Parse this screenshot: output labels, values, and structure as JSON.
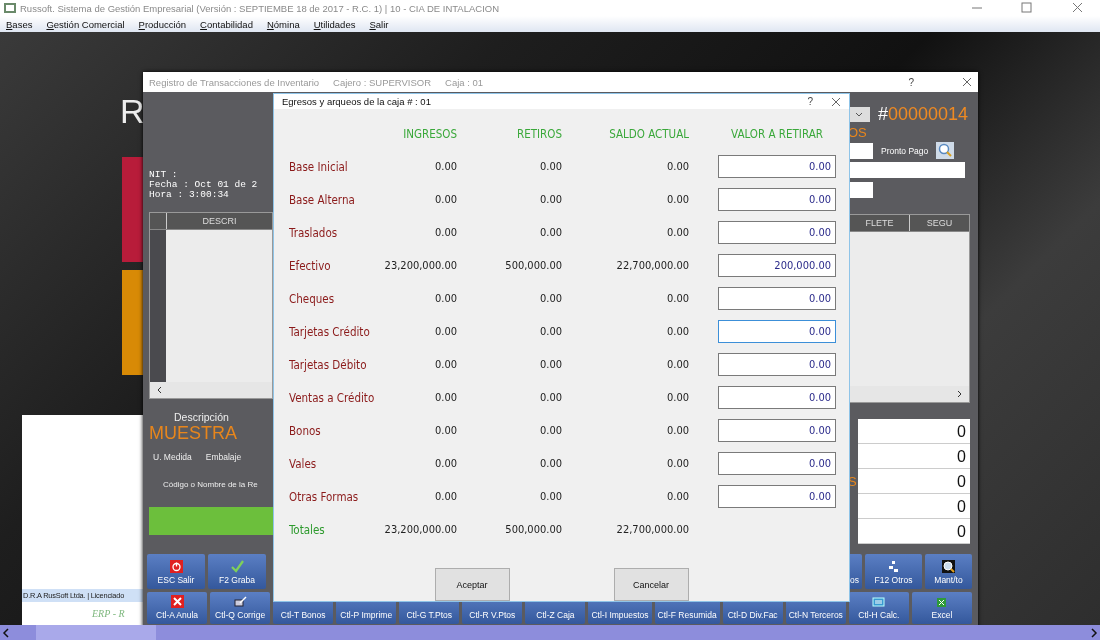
{
  "app": {
    "title": "Russoft. Sistema de Gestión Empresarial (Versión : SEPTIEMBE 18 de 2017 - R.C. 1) | 10 - CIA DE INTALACION"
  },
  "menu": [
    "Bases",
    "Gestión Comercial",
    "Producción",
    "Contabilidad",
    "Nómina",
    "Utilidades",
    "Salir"
  ],
  "desktop": {
    "logo_letter": "R",
    "license_text": "D.R.A RusSoft Ltda. | Licenciado",
    "logo_caption": "ERP - R"
  },
  "inventory_window": {
    "title": "Registro de Transacciones de Inventario",
    "cashier": "Cajero : SUPERVISOR",
    "box": "Caja : 01",
    "help": "?",
    "info": [
      "NIT :",
      "Fecha : Oct 01 de 2",
      "Hora  :  3:00:34"
    ],
    "grid_left_header": "DESCRI",
    "description_label": "Descripción",
    "product": "MUESTRA",
    "unit_labels": [
      "U. Medida",
      "Embalaje"
    ],
    "search_label": "Código o Nombre de la Re",
    "document_number_prefix": "#",
    "document_number": "00000014",
    "status_fragment": "OS",
    "pronto_pago": "Pronto Pago",
    "grid_right_headers": [
      "FLETE",
      "SEGU"
    ],
    "totals_fragment": "S",
    "totals": [
      "0",
      "0",
      "0",
      "0",
      "0"
    ],
    "buttons_top_left": [
      "ESC Salir",
      "F2 Graba"
    ],
    "buttons_top_right": [
      "os",
      "F12 Otros",
      "Mant/to"
    ],
    "buttons_bottom": [
      "Ctl-A Anula",
      "Ctl-Q Corrige",
      "Ctl-T Bonos",
      "Ctl-P Imprime",
      "Ctl-G T.Ptos",
      "Ctl-R V.Ptos",
      "Ctl-Z Caja",
      "Ctl-I Impuestos",
      "Ctl-F Resumida",
      "Ctl-D Div.Fac",
      "Ctl-N Terceros",
      "Ctl-H Calc.",
      "Excel"
    ]
  },
  "dialog": {
    "title": "Egresos y arqueos de la caja # : 01",
    "help": "?",
    "columns": [
      "INGRESOS",
      "RETIROS",
      "SALDO ACTUAL",
      "VALOR A RETIRAR"
    ],
    "rows": [
      {
        "label": "Base Inicial",
        "income": "0.00",
        "withdrawals": "0.00",
        "balance": "0.00",
        "amount": "0.00",
        "focused": false
      },
      {
        "label": "Base Alterna",
        "income": "0.00",
        "withdrawals": "0.00",
        "balance": "0.00",
        "amount": "0.00",
        "focused": false
      },
      {
        "label": "Traslados",
        "income": "0.00",
        "withdrawals": "0.00",
        "balance": "0.00",
        "amount": "0.00",
        "focused": false
      },
      {
        "label": "Efectivo",
        "income": "23,200,000.00",
        "withdrawals": "500,000.00",
        "balance": "22,700,000.00",
        "amount": "200,000.00",
        "focused": false
      },
      {
        "label": "Cheques",
        "income": "0.00",
        "withdrawals": "0.00",
        "balance": "0.00",
        "amount": "0.00",
        "focused": false
      },
      {
        "label": "Tarjetas Crédito",
        "income": "0.00",
        "withdrawals": "0.00",
        "balance": "0.00",
        "amount": "0.00",
        "focused": true
      },
      {
        "label": "Tarjetas Débito",
        "income": "0.00",
        "withdrawals": "0.00",
        "balance": "0.00",
        "amount": "0.00",
        "focused": false
      },
      {
        "label": "Ventas a Crédito",
        "income": "0.00",
        "withdrawals": "0.00",
        "balance": "0.00",
        "amount": "0.00",
        "focused": false
      },
      {
        "label": "Bonos",
        "income": "0.00",
        "withdrawals": "0.00",
        "balance": "0.00",
        "amount": "0.00",
        "focused": false
      },
      {
        "label": "Vales",
        "income": "0.00",
        "withdrawals": "0.00",
        "balance": "0.00",
        "amount": "0.00",
        "focused": false
      },
      {
        "label": "Otras Formas",
        "income": "0.00",
        "withdrawals": "0.00",
        "balance": "0.00",
        "amount": "0.00",
        "focused": false
      }
    ],
    "totals": {
      "label": "Totales",
      "income": "23,200,000.00",
      "withdrawals": "500,000.00",
      "balance": "22,700,000.00"
    },
    "buttons": [
      "Aceptar",
      "Cancelar"
    ]
  }
}
